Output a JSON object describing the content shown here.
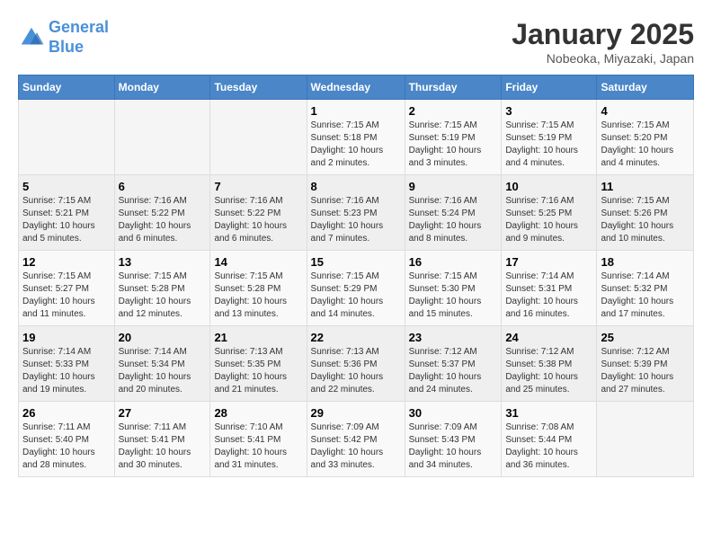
{
  "header": {
    "logo_line1": "General",
    "logo_line2": "Blue",
    "month": "January 2025",
    "location": "Nobeoka, Miyazaki, Japan"
  },
  "days_of_week": [
    "Sunday",
    "Monday",
    "Tuesday",
    "Wednesday",
    "Thursday",
    "Friday",
    "Saturday"
  ],
  "weeks": [
    [
      {
        "day": "",
        "info": ""
      },
      {
        "day": "",
        "info": ""
      },
      {
        "day": "",
        "info": ""
      },
      {
        "day": "1",
        "info": "Sunrise: 7:15 AM\nSunset: 5:18 PM\nDaylight: 10 hours\nand 2 minutes."
      },
      {
        "day": "2",
        "info": "Sunrise: 7:15 AM\nSunset: 5:19 PM\nDaylight: 10 hours\nand 3 minutes."
      },
      {
        "day": "3",
        "info": "Sunrise: 7:15 AM\nSunset: 5:19 PM\nDaylight: 10 hours\nand 4 minutes."
      },
      {
        "day": "4",
        "info": "Sunrise: 7:15 AM\nSunset: 5:20 PM\nDaylight: 10 hours\nand 4 minutes."
      }
    ],
    [
      {
        "day": "5",
        "info": "Sunrise: 7:15 AM\nSunset: 5:21 PM\nDaylight: 10 hours\nand 5 minutes."
      },
      {
        "day": "6",
        "info": "Sunrise: 7:16 AM\nSunset: 5:22 PM\nDaylight: 10 hours\nand 6 minutes."
      },
      {
        "day": "7",
        "info": "Sunrise: 7:16 AM\nSunset: 5:22 PM\nDaylight: 10 hours\nand 6 minutes."
      },
      {
        "day": "8",
        "info": "Sunrise: 7:16 AM\nSunset: 5:23 PM\nDaylight: 10 hours\nand 7 minutes."
      },
      {
        "day": "9",
        "info": "Sunrise: 7:16 AM\nSunset: 5:24 PM\nDaylight: 10 hours\nand 8 minutes."
      },
      {
        "day": "10",
        "info": "Sunrise: 7:16 AM\nSunset: 5:25 PM\nDaylight: 10 hours\nand 9 minutes."
      },
      {
        "day": "11",
        "info": "Sunrise: 7:15 AM\nSunset: 5:26 PM\nDaylight: 10 hours\nand 10 minutes."
      }
    ],
    [
      {
        "day": "12",
        "info": "Sunrise: 7:15 AM\nSunset: 5:27 PM\nDaylight: 10 hours\nand 11 minutes."
      },
      {
        "day": "13",
        "info": "Sunrise: 7:15 AM\nSunset: 5:28 PM\nDaylight: 10 hours\nand 12 minutes."
      },
      {
        "day": "14",
        "info": "Sunrise: 7:15 AM\nSunset: 5:28 PM\nDaylight: 10 hours\nand 13 minutes."
      },
      {
        "day": "15",
        "info": "Sunrise: 7:15 AM\nSunset: 5:29 PM\nDaylight: 10 hours\nand 14 minutes."
      },
      {
        "day": "16",
        "info": "Sunrise: 7:15 AM\nSunset: 5:30 PM\nDaylight: 10 hours\nand 15 minutes."
      },
      {
        "day": "17",
        "info": "Sunrise: 7:14 AM\nSunset: 5:31 PM\nDaylight: 10 hours\nand 16 minutes."
      },
      {
        "day": "18",
        "info": "Sunrise: 7:14 AM\nSunset: 5:32 PM\nDaylight: 10 hours\nand 17 minutes."
      }
    ],
    [
      {
        "day": "19",
        "info": "Sunrise: 7:14 AM\nSunset: 5:33 PM\nDaylight: 10 hours\nand 19 minutes."
      },
      {
        "day": "20",
        "info": "Sunrise: 7:14 AM\nSunset: 5:34 PM\nDaylight: 10 hours\nand 20 minutes."
      },
      {
        "day": "21",
        "info": "Sunrise: 7:13 AM\nSunset: 5:35 PM\nDaylight: 10 hours\nand 21 minutes."
      },
      {
        "day": "22",
        "info": "Sunrise: 7:13 AM\nSunset: 5:36 PM\nDaylight: 10 hours\nand 22 minutes."
      },
      {
        "day": "23",
        "info": "Sunrise: 7:12 AM\nSunset: 5:37 PM\nDaylight: 10 hours\nand 24 minutes."
      },
      {
        "day": "24",
        "info": "Sunrise: 7:12 AM\nSunset: 5:38 PM\nDaylight: 10 hours\nand 25 minutes."
      },
      {
        "day": "25",
        "info": "Sunrise: 7:12 AM\nSunset: 5:39 PM\nDaylight: 10 hours\nand 27 minutes."
      }
    ],
    [
      {
        "day": "26",
        "info": "Sunrise: 7:11 AM\nSunset: 5:40 PM\nDaylight: 10 hours\nand 28 minutes."
      },
      {
        "day": "27",
        "info": "Sunrise: 7:11 AM\nSunset: 5:41 PM\nDaylight: 10 hours\nand 30 minutes."
      },
      {
        "day": "28",
        "info": "Sunrise: 7:10 AM\nSunset: 5:41 PM\nDaylight: 10 hours\nand 31 minutes."
      },
      {
        "day": "29",
        "info": "Sunrise: 7:09 AM\nSunset: 5:42 PM\nDaylight: 10 hours\nand 33 minutes."
      },
      {
        "day": "30",
        "info": "Sunrise: 7:09 AM\nSunset: 5:43 PM\nDaylight: 10 hours\nand 34 minutes."
      },
      {
        "day": "31",
        "info": "Sunrise: 7:08 AM\nSunset: 5:44 PM\nDaylight: 10 hours\nand 36 minutes."
      },
      {
        "day": "",
        "info": ""
      }
    ]
  ]
}
